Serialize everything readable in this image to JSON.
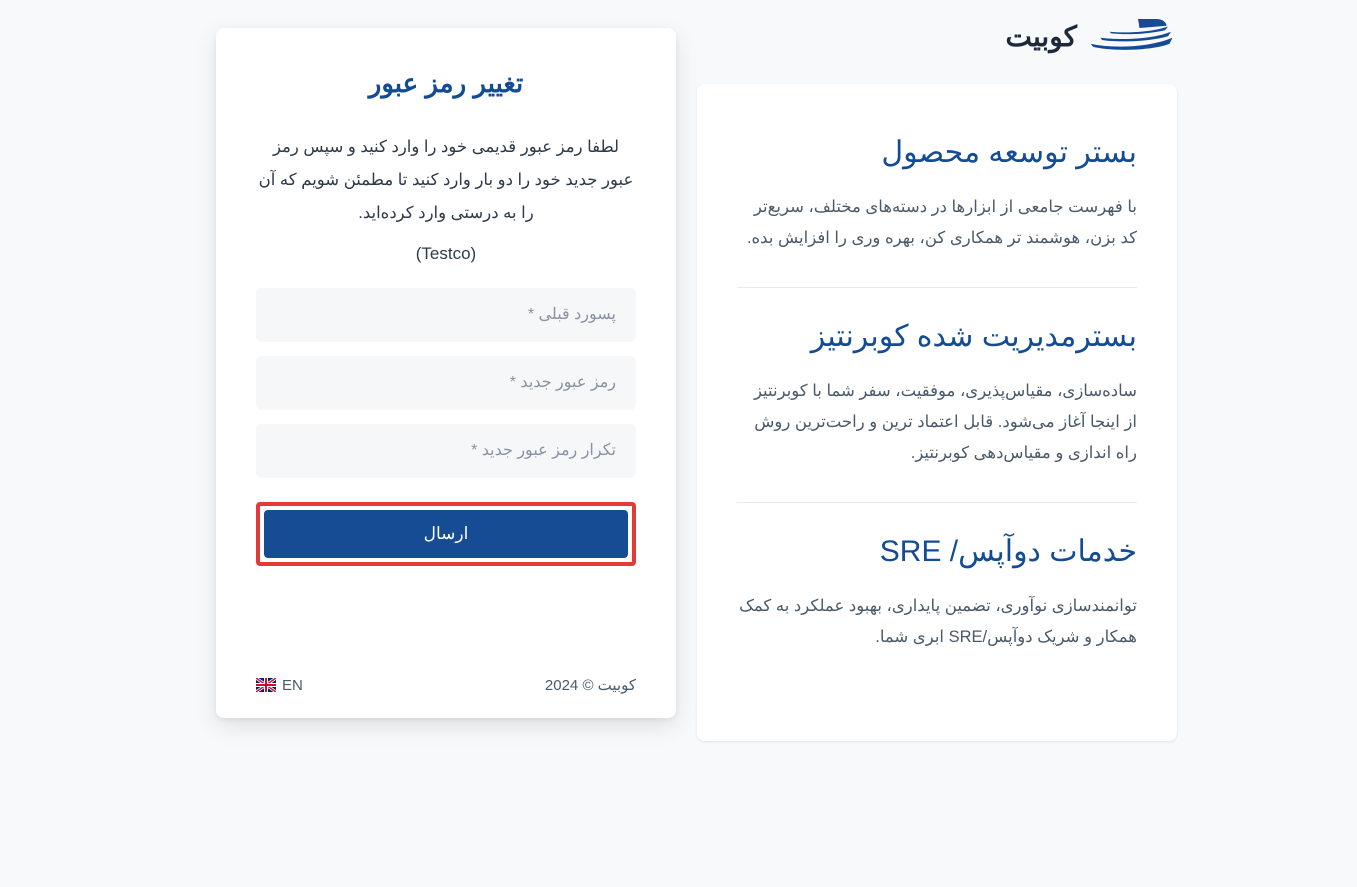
{
  "brand": {
    "name": "کوبیت"
  },
  "features": [
    {
      "title": "بستر توسعه محصول",
      "desc": "با فهرست جامعی از ابزارها در دسته‌های مختلف، سریع‌تر کد بزن، هوشمند تر همکاری کن، بهره وری را افزایش بده."
    },
    {
      "title": "بسترمدیریت شده کوبرنتیز",
      "desc": "ساده‌سازی، مقیاس‌پذیری، موفقیت، سفر شما با کوبرنتیز از اینجا آغاز می‌شود. قابل اعتماد ترین و راحت‌ترین روش راه اندازی و مقیاس‌دهی کوبرنتیز."
    },
    {
      "title": "خدمات دوآپس/ SRE",
      "desc": "توانمندسازی نوآوری، تضمین پایداری، بهبود عملکرد به کمک همکار و شریک دوآپس/SRE ابری شما."
    }
  ],
  "form": {
    "title": "تغییر رمز عبور",
    "intro": "لطفا رمز عبور قدیمی خود را وارد کنید و سپس رمز عبور جدید خود را دو بار وارد کنید تا مطمئن شویم که آن را به درستی وارد کرده‌اید.",
    "company": "(Testco)",
    "old_password_placeholder": "پسورد قبلی *",
    "new_password_placeholder": "رمز عبور جدید *",
    "confirm_password_placeholder": "تکرار رمز عبور جدید *",
    "submit_label": "ارسال"
  },
  "footer": {
    "lang_label": "EN",
    "copyright": "کوبیت © 2024"
  }
}
